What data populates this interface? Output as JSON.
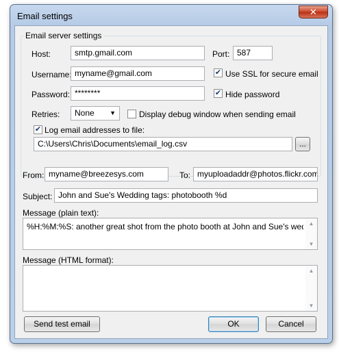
{
  "window": {
    "title": "Email settings",
    "close_label": "✕"
  },
  "server_group": {
    "title": "Email server settings",
    "host_label": "Host:",
    "host_value": "smtp.gmail.com",
    "port_label": "Port:",
    "port_value": "587",
    "username_label": "Username:",
    "username_value": "myname@gmail.com",
    "use_ssl_label": "Use SSL for secure email",
    "use_ssl_checked": true,
    "password_label": "Password:",
    "password_value": "********",
    "hide_password_label": "Hide password",
    "hide_password_checked": true,
    "retries_label": "Retries:",
    "retries_value": "None",
    "debug_label": "Display debug window when sending email",
    "debug_checked": false,
    "log_label": "Log email addresses to file:",
    "log_checked": true,
    "log_path": "C:\\Users\\Chris\\Documents\\email_log.csv",
    "browse_label": "..."
  },
  "message": {
    "from_label": "From:",
    "from_value": "myname@breezesys.com",
    "to_label": "To:",
    "to_value": "myuploadaddr@photos.flickr.com",
    "subject_label": "Subject:",
    "subject_value": "John and Sue's Wedding tags: photobooth %d",
    "plain_label": "Message (plain text):",
    "plain_value": "%H:%M:%S: another great shot from the photo booth at John and Sue's wedding",
    "html_label": "Message (HTML format):",
    "html_value": ""
  },
  "buttons": {
    "send_test": "Send test email",
    "ok": "OK",
    "cancel": "Cancel"
  }
}
